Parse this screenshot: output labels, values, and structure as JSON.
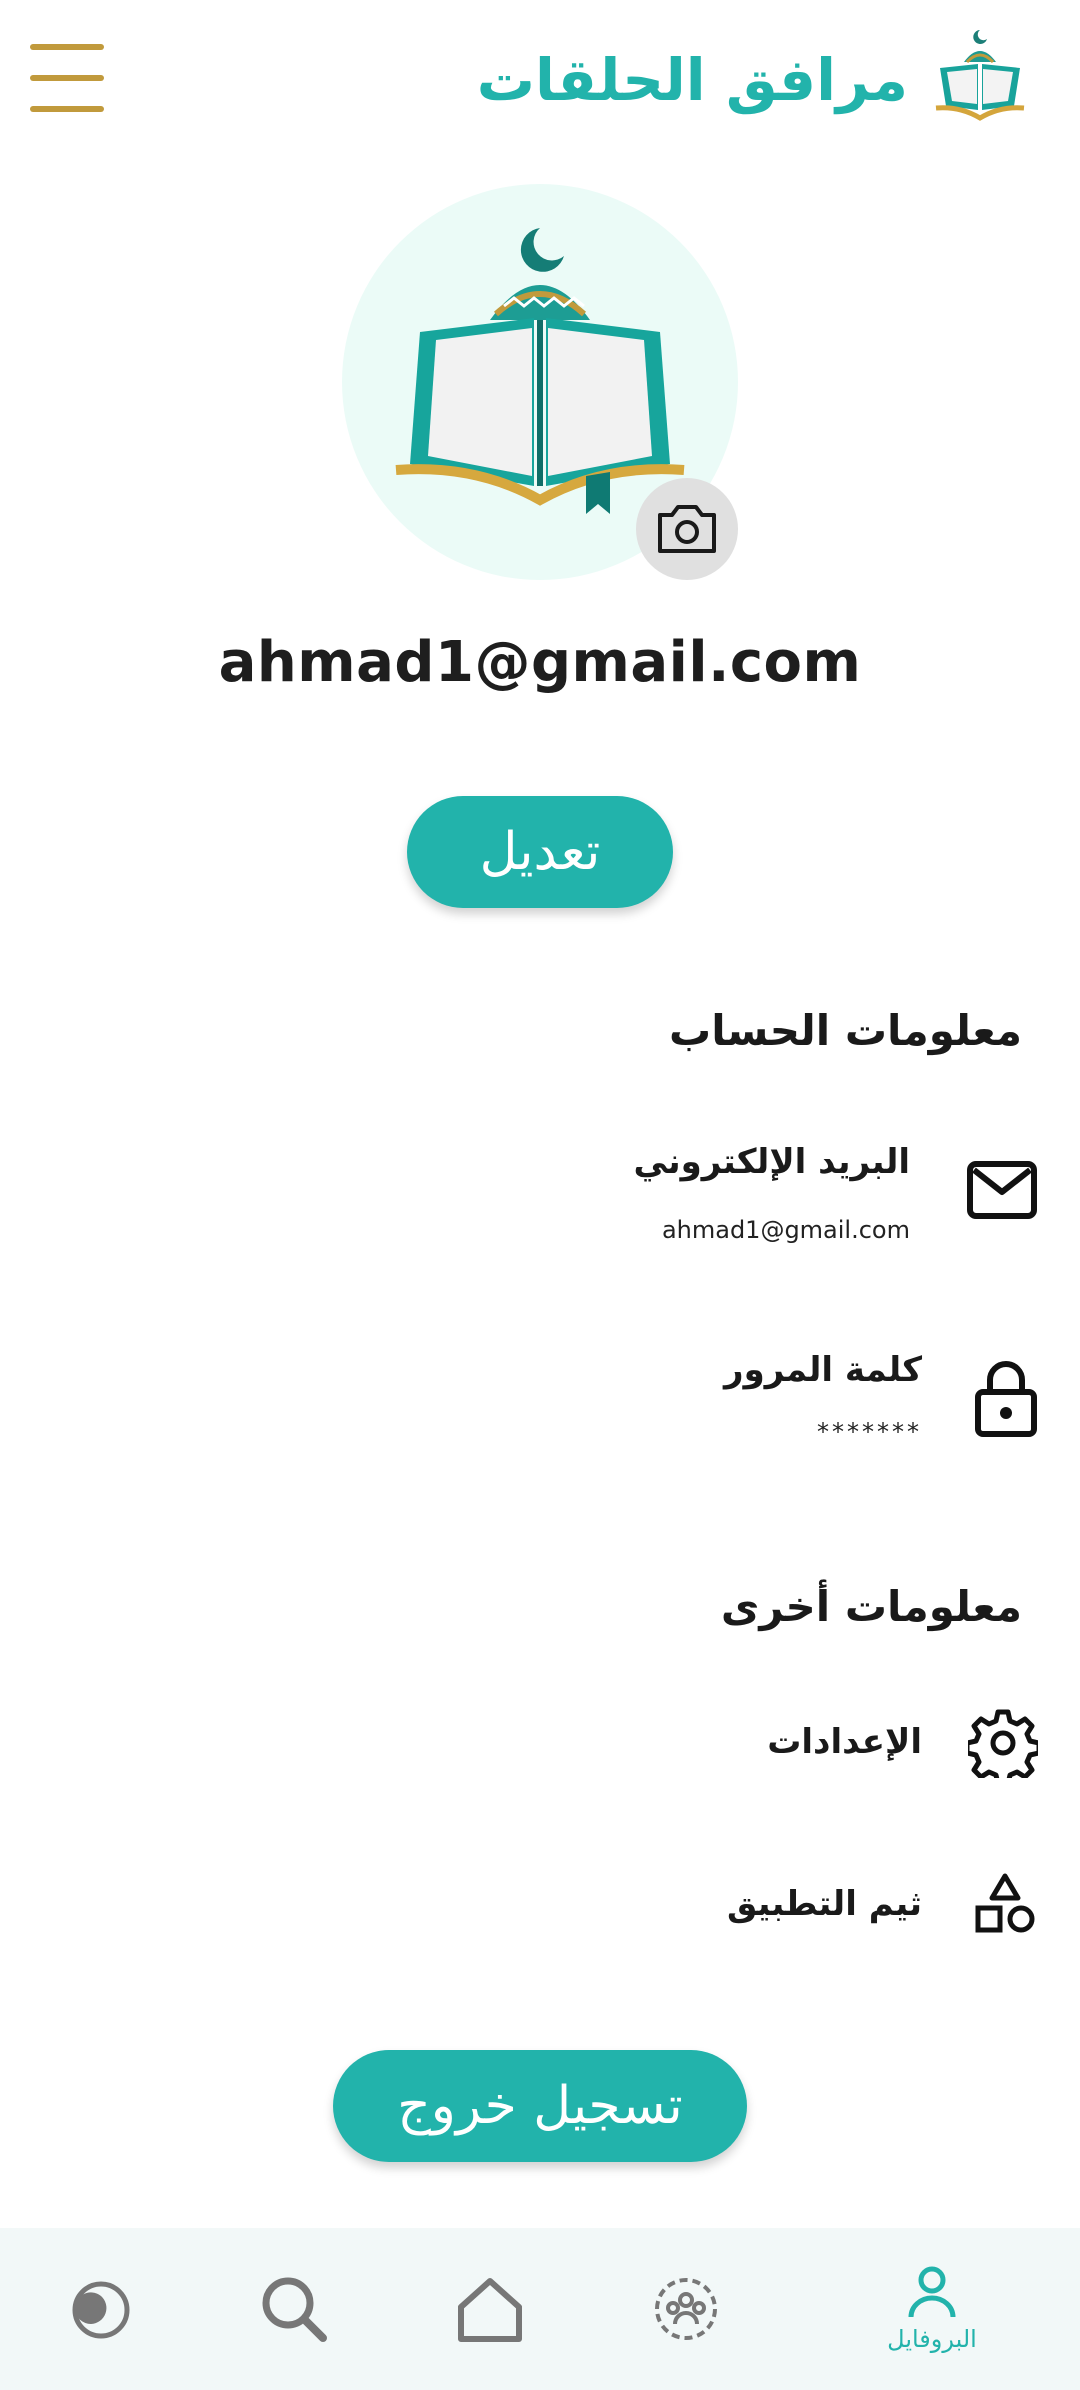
{
  "header": {
    "app_title": "مرافق الحلقات",
    "menu_icon": "hamburger-menu-icon",
    "logo_icon": "quran-mosque-logo"
  },
  "profile": {
    "email": "ahmad1@gmail.com",
    "avatar_icon": "quran-mosque-logo",
    "camera_icon": "camera-icon",
    "edit_label": "تعديل"
  },
  "account_section": {
    "title": "معلومات الحساب",
    "email_row": {
      "label": "البريد الإلكتروني",
      "value": "ahmad1@gmail.com",
      "icon": "mail-icon"
    },
    "password_row": {
      "label": "كلمة المرور",
      "value": "*******",
      "icon": "lock-icon"
    }
  },
  "other_section": {
    "title": "معلومات أخرى",
    "settings_row": {
      "label": "الإعدادات",
      "icon": "gear-icon"
    },
    "theme_row": {
      "label": "ثيم التطبيق",
      "icon": "shapes-icon"
    }
  },
  "logout_label": "تسجيل خروج",
  "bottom_nav": {
    "items": [
      {
        "icon": "pie-chart-icon",
        "label": ""
      },
      {
        "icon": "search-icon",
        "label": ""
      },
      {
        "icon": "home-icon",
        "label": ""
      },
      {
        "icon": "group-icon",
        "label": ""
      },
      {
        "icon": "user-icon",
        "label": "البروفايل",
        "active": true
      }
    ]
  },
  "colors": {
    "accent": "#22b3ab",
    "gold": "#c19a3c",
    "nav_background": "#f2f8f8",
    "avatar_background": "#ebfbf7"
  }
}
